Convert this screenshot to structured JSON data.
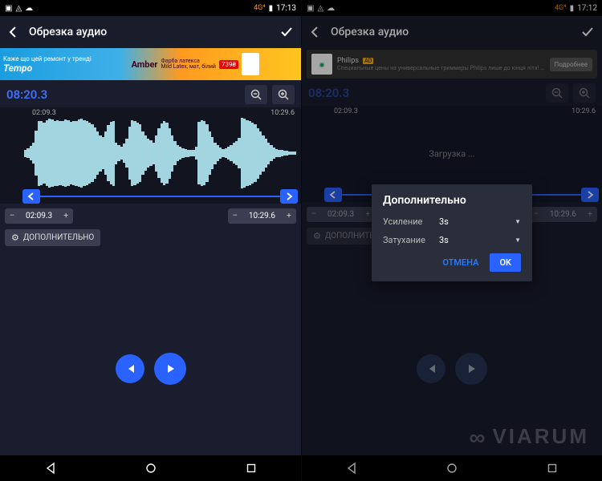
{
  "left": {
    "statusbar": {
      "signal": "4G⁴",
      "battery": "▯",
      "time": "17:13"
    },
    "appbar": {
      "title": "Обрезка аудио"
    },
    "ad": {
      "text1": "Kaже що цей ремонт у тренді",
      "brand": "Tempo",
      "text2": "Amber Фарба латекса Mild Latex, мат, білий",
      "price": "739"
    },
    "total_time": "08:20.3",
    "wave": {
      "start_label": "02:09.3",
      "end_label": "10:29.6"
    },
    "chips": {
      "start": "02:09.3",
      "end": "10:29.6"
    },
    "advanced_label": "ДОПОЛНИТЕЛЬНО"
  },
  "right": {
    "statusbar": {
      "signal": "4G⁴",
      "battery": "▯",
      "time": "17:12"
    },
    "appbar": {
      "title": "Обрезка аудио"
    },
    "ad": {
      "brand": "Philips",
      "tag": "AD",
      "text": "Специальные цены на универсальные триммеры Philips лише до кінця літа! Поспішайте замовити в...",
      "cta": "Подробнее"
    },
    "total_time": "08:20.3",
    "wave": {
      "start_label": "02:09.3",
      "end_label": "10:29.6",
      "loading": "Загрузка ..."
    },
    "chips": {
      "start": "02:09.3",
      "end": "10:29.6"
    },
    "advanced_label": "ДОПОЛНИТЕЛЬНО",
    "dialog": {
      "title": "Дополнительно",
      "gain_label": "Усиление",
      "gain_value": "3s",
      "fade_label": "Затухание",
      "fade_value": "3s",
      "cancel": "ОТМЕНА",
      "ok": "OK"
    }
  },
  "watermark": "VIARUM"
}
